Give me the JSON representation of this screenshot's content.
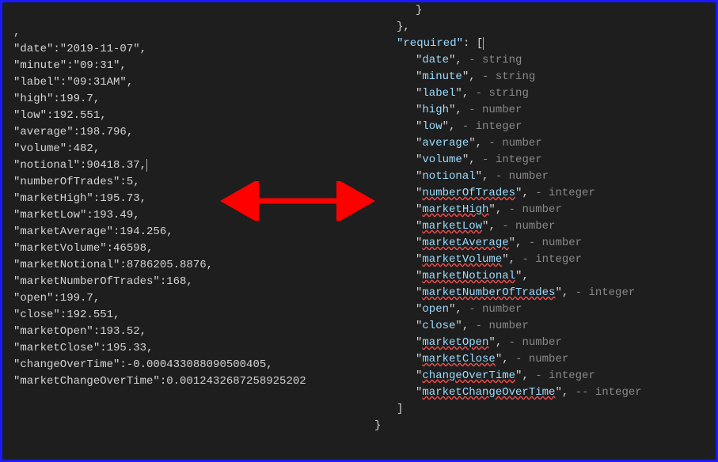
{
  "left": {
    "fields": [
      {
        "key": "date",
        "value": "2019-11-07",
        "quoted": true
      },
      {
        "key": "minute",
        "value": "09:31",
        "quoted": true
      },
      {
        "key": "label",
        "value": "09:31AM",
        "quoted": true
      },
      {
        "key": "high",
        "value": "199.7",
        "quoted": false
      },
      {
        "key": "low",
        "value": "192.551",
        "quoted": false
      },
      {
        "key": "average",
        "value": "198.796",
        "quoted": false
      },
      {
        "key": "volume",
        "value": "482",
        "quoted": false
      },
      {
        "key": "notional",
        "value": "90418.37",
        "quoted": false,
        "cursor": true
      },
      {
        "key": "numberOfTrades",
        "value": "5",
        "quoted": false
      },
      {
        "key": "marketHigh",
        "value": "195.73",
        "quoted": false
      },
      {
        "key": "marketLow",
        "value": "193.49",
        "quoted": false
      },
      {
        "key": "marketAverage",
        "value": "194.256",
        "quoted": false
      },
      {
        "key": "marketVolume",
        "value": "46598",
        "quoted": false
      },
      {
        "key": "marketNotional",
        "value": "8786205.8876",
        "quoted": false
      },
      {
        "key": "marketNumberOfTrades",
        "value": "168",
        "quoted": false
      },
      {
        "key": "open",
        "value": "199.7",
        "quoted": false
      },
      {
        "key": "close",
        "value": "192.551",
        "quoted": false
      },
      {
        "key": "marketOpen",
        "value": "193.52",
        "quoted": false
      },
      {
        "key": "marketClose",
        "value": "195.33",
        "quoted": false
      },
      {
        "key": "changeOverTime",
        "value": "-0.000433088090500405",
        "quoted": false
      },
      {
        "key": "marketChangeOverTime",
        "value": "0.0012432687258925202",
        "quoted": false,
        "last": true
      }
    ]
  },
  "right": {
    "header": "\"required\": [",
    "items": [
      {
        "key": "date",
        "type": "string",
        "underline": false
      },
      {
        "key": "minute",
        "type": "string",
        "underline": false
      },
      {
        "key": "label",
        "type": "string",
        "underline": false
      },
      {
        "key": "high",
        "type": "number",
        "underline": false
      },
      {
        "key": "low",
        "type": "integer",
        "underline": false
      },
      {
        "key": "average",
        "type": "number",
        "underline": false
      },
      {
        "key": "volume",
        "type": "integer",
        "underline": false
      },
      {
        "key": "notional",
        "type": "number",
        "underline": false
      },
      {
        "key": "numberOfTrades",
        "type": "integer",
        "underline": true
      },
      {
        "key": "marketHigh",
        "type": "number",
        "underline": true
      },
      {
        "key": "marketLow",
        "type": "number",
        "underline": true
      },
      {
        "key": "marketAverage",
        "type": "number",
        "underline": true
      },
      {
        "key": "marketVolume",
        "type": "integer",
        "underline": true
      },
      {
        "key": "marketNotional",
        "type": "",
        "underline": true
      },
      {
        "key": "marketNumberOfTrades",
        "type": "integer",
        "underline": true
      },
      {
        "key": "open",
        "type": "number",
        "underline": false
      },
      {
        "key": "close",
        "type": "number",
        "underline": false
      },
      {
        "key": "marketOpen",
        "type": "number",
        "underline": true
      },
      {
        "key": "marketClose",
        "type": "number",
        "underline": true
      },
      {
        "key": "changeOverTime",
        "type": "integer",
        "underline": true
      },
      {
        "key": "marketChangeOverTime",
        "type": "integer",
        "underline": true,
        "sep": " -- "
      }
    ],
    "footer1": "]",
    "footer2": "}"
  }
}
